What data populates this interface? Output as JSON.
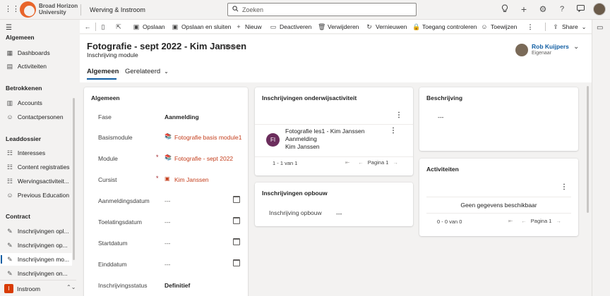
{
  "topbar": {
    "logo_line1": "Broad Horizon",
    "logo_line2": "University",
    "app_name": "Werving & Instroom",
    "search_placeholder": "Zoeken"
  },
  "leftnav": {
    "sections": [
      {
        "title": "Algemeen",
        "items": [
          {
            "label": "Dashboards",
            "icon": "dashboard-icon"
          },
          {
            "label": "Activiteiten",
            "icon": "activity-icon"
          }
        ]
      },
      {
        "title": "Betrokkenen",
        "items": [
          {
            "label": "Accounts",
            "icon": "building-icon"
          },
          {
            "label": "Contactpersonen",
            "icon": "person-icon"
          }
        ]
      },
      {
        "title": "Leaddossier",
        "items": [
          {
            "label": "Interesses",
            "icon": "list-icon"
          },
          {
            "label": "Content registraties",
            "icon": "list-icon"
          },
          {
            "label": "Wervingsactiviteit...",
            "icon": "list-icon"
          },
          {
            "label": "Previous Education",
            "icon": "person-icon"
          }
        ]
      },
      {
        "title": "Contract",
        "items": [
          {
            "label": "Inschrijvingen opl...",
            "icon": "edit-icon"
          },
          {
            "label": "Inschrijvingen op...",
            "icon": "edit-icon"
          },
          {
            "label": "Inschrijvingen mo...",
            "icon": "edit-icon",
            "active": true
          },
          {
            "label": "Inschrijvingen on...",
            "icon": "edit-icon"
          }
        ]
      }
    ],
    "area": {
      "badge": "I",
      "label": "Instroom"
    }
  },
  "commandbar": {
    "opslaan": "Opslaan",
    "opslaan_sluiten": "Opslaan en sluiten",
    "nieuw": "Nieuw",
    "deactiveren": "Deactiveren",
    "verwijderen": "Verwijderen",
    "vernieuwen": "Vernieuwen",
    "toegang": "Toegang controleren",
    "toewijzen": "Toewijzen",
    "share": "Share"
  },
  "header": {
    "title": "Fotografie - sept 2022 - Kim Janssen",
    "saved": "- Saved",
    "subtitle": "Inschrijving module",
    "owner_name": "Rob Kuijpers",
    "owner_role": "Eigenaar"
  },
  "tabs": {
    "algemeen": "Algemeen",
    "gerelateerd": "Gerelateerd"
  },
  "form": {
    "section_title": "Algemeen",
    "fields": {
      "fase": {
        "label": "Fase",
        "value": "Aanmelding"
      },
      "basismodule": {
        "label": "Basismodule",
        "value": "Fotografie basis module1"
      },
      "module": {
        "label": "Module",
        "value": "Fotografie - sept 2022"
      },
      "cursist": {
        "label": "Cursist",
        "value": "Kim Janssen"
      },
      "aanmeldingsdatum": {
        "label": "Aanmeldingsdatum",
        "value": "---"
      },
      "toelatingsdatum": {
        "label": "Toelatingsdatum",
        "value": "---"
      },
      "startdatum": {
        "label": "Startdatum",
        "value": "---"
      },
      "einddatum": {
        "label": "Einddatum",
        "value": "---"
      },
      "status": {
        "label": "Inschrijvingsstatus",
        "value": "Definitief"
      }
    },
    "required_mark": "*"
  },
  "onderwijs": {
    "title": "Inschrijvingen onderwijsactiviteit",
    "record": {
      "initials": "FI",
      "line1": "Fotografie les1 - Kim Janssen",
      "line2": "Aanmelding",
      "line3": "Kim Janssen",
      "avatar_color": "#6b2d5c"
    },
    "count": "1 - 1 van 1",
    "page": "Pagina 1"
  },
  "opbouw": {
    "title": "Inschrijvingen opbouw",
    "label": "Inschrijving opbouw",
    "value": "---"
  },
  "beschrijving": {
    "title": "Beschrijving",
    "value": "---"
  },
  "activiteiten": {
    "title": "Activiteiten",
    "empty": "Geen gegevens beschikbaar",
    "count": "0 - 0 van 0",
    "page": "Pagina 1"
  },
  "colors": {
    "accent": "#115ea3",
    "link": "#c43e1c",
    "brand": "#e8652b"
  }
}
